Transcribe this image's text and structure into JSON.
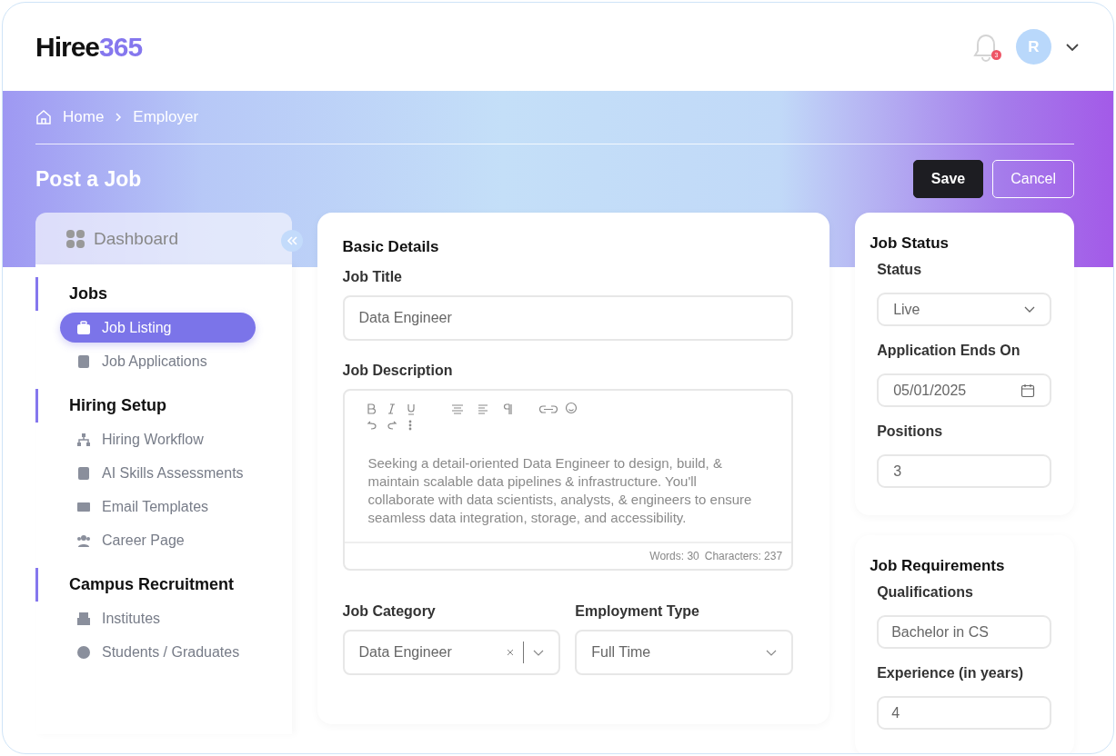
{
  "header": {
    "logo": {
      "word": "Hiree",
      "digits": "365"
    },
    "notifications": {
      "count": "3"
    },
    "avatar": {
      "initial": "R"
    }
  },
  "breadcrumb": [
    "Home",
    "Employer"
  ],
  "page": {
    "title": "Post a Job",
    "buttons": [
      {
        "label": "Save",
        "kind": "primary"
      },
      {
        "label": "Cancel",
        "kind": "secondary"
      }
    ]
  },
  "sidebar": {
    "dashboard": "Dashboard",
    "sections": [
      {
        "title": "Jobs",
        "items": [
          {
            "label": "Job Listing",
            "selected": true
          },
          {
            "label": "Job Applications",
            "selected": false
          }
        ]
      },
      {
        "title": "Hiring Setup",
        "items": [
          {
            "label": "Hiring Workflow",
            "selected": false
          },
          {
            "label": "AI Skills Assessments",
            "selected": false
          },
          {
            "label": "Email Templates",
            "selected": false
          },
          {
            "label": "Career Page",
            "selected": false
          }
        ]
      },
      {
        "title": "Campus Recruitment",
        "items": [
          {
            "label": "Institutes",
            "selected": false
          },
          {
            "label": "Students / Graduates",
            "selected": false
          }
        ]
      }
    ]
  },
  "basic_details": {
    "title": "Basic Details",
    "job_title": {
      "label": "Job Title",
      "value": "Data Engineer"
    },
    "job_description": {
      "label": "Job Description",
      "value": "Seeking a detail-oriented Data Engineer to design, build, & maintain scalable data pipelines & infrastructure. You'll collaborate with data scientists, analysts, & engineers to ensure seamless data integration, storage, and accessibility.",
      "words": "Words: 30",
      "characters": "Characters: 237"
    },
    "job_category": {
      "label": "Job Category",
      "value": "Data Engineer"
    },
    "employment_type": {
      "label": "Employment Type",
      "value": "Full Time"
    }
  },
  "job_status": {
    "title": "Job Status",
    "status": {
      "label": "Status",
      "value": "Live"
    },
    "ends_on": {
      "label": "Application Ends On",
      "value": "05/01/2025"
    },
    "positions": {
      "label": "Positions",
      "value": "3"
    }
  },
  "job_requirements": {
    "title": "Job Requirements",
    "qualifications": {
      "label": "Qualifications",
      "value": "Bachelor in CS"
    },
    "experience": {
      "label": "Experience (in years)",
      "value": "4"
    }
  }
}
